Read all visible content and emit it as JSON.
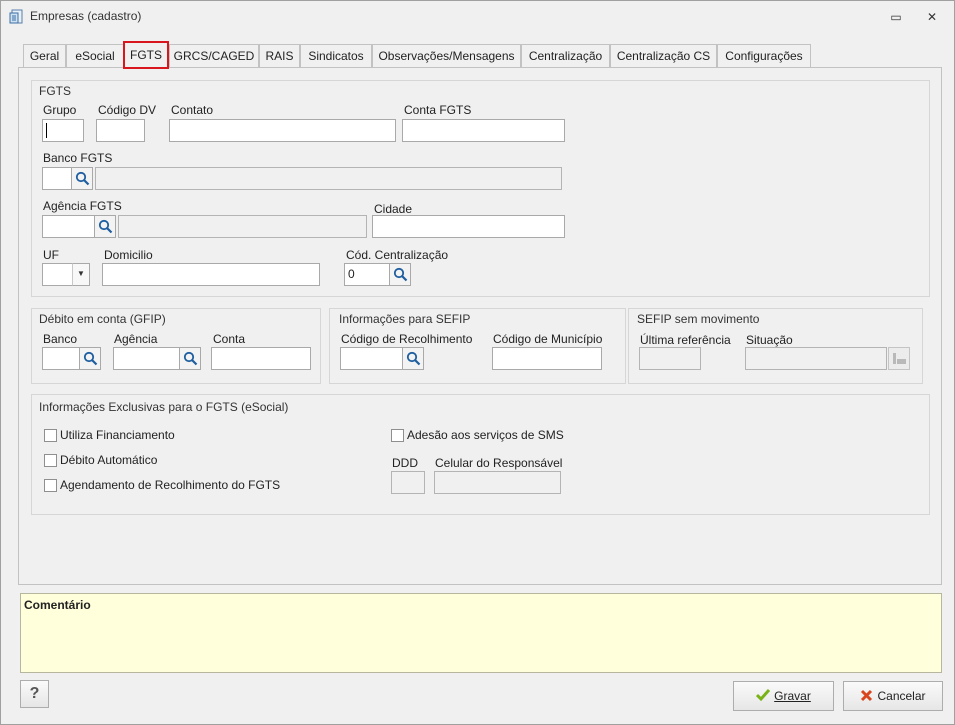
{
  "window": {
    "title": "Empresas (cadastro)",
    "restore_glyph": "▭",
    "close_glyph": "✕"
  },
  "tabs": [
    {
      "label": "Geral"
    },
    {
      "label": "eSocial"
    },
    {
      "label": "FGTS",
      "active": true
    },
    {
      "label": "GRCS/CAGED"
    },
    {
      "label": "RAIS"
    },
    {
      "label": "Sindicatos"
    },
    {
      "label": "Observações/Mensagens"
    },
    {
      "label": "Centralização"
    },
    {
      "label": "Centralização CS"
    },
    {
      "label": "Configurações"
    }
  ],
  "fgts": {
    "title": "FGTS",
    "grupo_label": "Grupo",
    "codigo_dv_label": "Código DV",
    "contato_label": "Contato",
    "conta_fgts_label": "Conta FGTS",
    "banco_fgts_label": "Banco FGTS",
    "agencia_fgts_label": "Agência FGTS",
    "cidade_label": "Cidade",
    "uf_label": "UF",
    "domicilio_label": "Domicilio",
    "cod_centralizacao_label": "Cód. Centralização",
    "cod_centralizacao_value": "0"
  },
  "debito": {
    "title": "Débito em conta (GFIP)",
    "banco_label": "Banco",
    "agencia_label": "Agência",
    "conta_label": "Conta"
  },
  "sefip": {
    "title": "Informações para SEFIP",
    "codigo_recolhimento_label": "Código de Recolhimento",
    "codigo_municipio_label": "Código de Município"
  },
  "sefip_sem_mov": {
    "title": "SEFIP sem movimento",
    "ultima_referencia_label": "Última referência",
    "situacao_label": "Situação"
  },
  "esocial": {
    "title": "Informações Exclusivas para o FGTS (eSocial)",
    "utiliza_financiamento": "Utiliza Financiamento",
    "debito_automatico": "Débito Automático",
    "agendamento": "Agendamento de Recolhimento do FGTS",
    "adesao_sms": "Adesão aos serviços de SMS",
    "ddd_label": "DDD",
    "celular_label": "Celular do Responsável"
  },
  "comment": {
    "label": "Comentário"
  },
  "footer": {
    "help_label": "?",
    "save_label": "Gravar",
    "cancel_label": "Cancelar"
  },
  "colors": {
    "active_tab_border": "#d9161d",
    "comment_bg": "#ffffdc",
    "save_icon": "#7ab317",
    "cancel_icon": "#d9461d"
  },
  "icons": {
    "search": "magnifier-icon",
    "save": "checkmark-icon",
    "cancel": "x-icon",
    "help": "question-icon",
    "window": "document-icon"
  }
}
